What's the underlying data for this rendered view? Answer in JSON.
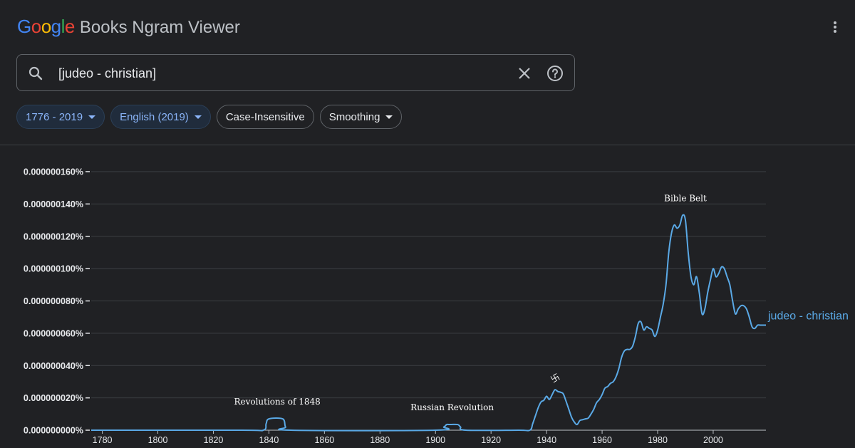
{
  "header": {
    "logo_letters": [
      "G",
      "o",
      "o",
      "g",
      "l",
      "e"
    ],
    "product": "Books Ngram Viewer",
    "menu_icon": "kebab-menu-icon"
  },
  "search": {
    "query": "[judeo - christian]",
    "icons": [
      "search-icon",
      "clear-icon",
      "help-icon"
    ]
  },
  "filters": {
    "year_range": "1776 - 2019",
    "corpus": "English (2019)",
    "case": "Case-Insensitive",
    "smoothing": "Smoothing"
  },
  "colors": {
    "series": "#5aa9e6",
    "accent": "#8ab4f8",
    "background": "#202124"
  },
  "chart_data": {
    "type": "line",
    "title": "",
    "xlabel": "",
    "ylabel": "",
    "xlim": [
      1776,
      2019
    ],
    "ylim": [
      0,
      1.6e-07
    ],
    "x_ticks": [
      1780,
      1800,
      1820,
      1840,
      1860,
      1880,
      1900,
      1920,
      1940,
      1960,
      1980,
      2000
    ],
    "x_tick_labels": [
      "1780",
      "1800",
      "1820",
      "1840",
      "1860",
      "1880",
      "1900",
      "1920",
      "1940",
      "1960",
      "1980",
      "2000"
    ],
    "y_ticks": [
      0,
      2e-08,
      4e-08,
      6e-08,
      8e-08,
      1e-07,
      1.2e-07,
      1.4e-07,
      1.6e-07
    ],
    "y_tick_labels": [
      "0.000000000%",
      "0.000000020%",
      "0.000000040%",
      "0.000000060%",
      "0.000000080%",
      "0.000000100%",
      "0.000000120%",
      "0.000000140%",
      "0.000000160%"
    ],
    "grid": true,
    "series": [
      {
        "name": "judeo - christian",
        "x": [
          1776,
          1830,
          1838,
          1839,
          1840,
          1845,
          1846,
          1848,
          1900,
          1903,
          1904,
          1905,
          1908,
          1909,
          1911,
          1930,
          1934,
          1935,
          1936,
          1937,
          1938,
          1939,
          1940,
          1941,
          1942,
          1943,
          1944,
          1945,
          1946,
          1947,
          1948,
          1949,
          1950,
          1951,
          1952,
          1953,
          1954,
          1955,
          1956,
          1957,
          1958,
          1959,
          1960,
          1961,
          1962,
          1963,
          1964,
          1965,
          1966,
          1967,
          1968,
          1969,
          1970,
          1971,
          1972,
          1973,
          1974,
          1975,
          1976,
          1977,
          1978,
          1979,
          1980,
          1981,
          1982,
          1983,
          1984,
          1985,
          1986,
          1987,
          1988,
          1989,
          1990,
          1991,
          1992,
          1993,
          1994,
          1995,
          1996,
          1997,
          1998,
          1999,
          2000,
          2001,
          2002,
          2003,
          2004,
          2005,
          2006,
          2007,
          2008,
          2009,
          2010,
          2011,
          2012,
          2013,
          2014,
          2015,
          2016,
          2017,
          2018,
          2019
        ],
        "values": [
          0,
          0,
          0,
          4e-09,
          7e-09,
          7e-09,
          2e-09,
          0,
          0,
          2e-09,
          3.5e-09,
          3.5e-09,
          3.5e-09,
          2e-09,
          0,
          0,
          0,
          4e-09,
          9e-09,
          1.4e-08,
          1.75e-08,
          1.85e-08,
          2.1e-08,
          1.9e-08,
          2.2e-08,
          2.5e-08,
          2.4e-08,
          2.35e-08,
          2.25e-08,
          1.8e-08,
          1.3e-08,
          8e-09,
          5e-09,
          3.5e-09,
          6e-09,
          6.5e-09,
          7e-09,
          7.5e-09,
          1e-08,
          1.3e-08,
          1.7e-08,
          1.9e-08,
          2.2e-08,
          2.6e-08,
          2.7e-08,
          2.9e-08,
          3e-08,
          3.3e-08,
          3.8e-08,
          4.5e-08,
          4.9e-08,
          5e-08,
          5e-08,
          5.2e-08,
          5.8e-08,
          6.6e-08,
          6.7e-08,
          6.2e-08,
          6.4e-08,
          6.3e-08,
          6.2e-08,
          5.8e-08,
          6.2e-08,
          7e-08,
          7.8e-08,
          9e-08,
          1.1e-07,
          1.22e-07,
          1.27e-07,
          1.25e-07,
          1.27e-07,
          1.33e-07,
          1.3e-07,
          1.1e-07,
          9.5e-08,
          9e-08,
          9.5e-08,
          8.5e-08,
          7.2e-08,
          7.5e-08,
          8.5e-08,
          9.3e-08,
          1e-07,
          9.5e-08,
          9.7e-08,
          1.01e-07,
          1e-07,
          9.5e-08,
          9e-08,
          8e-08,
          7.2e-08,
          7.5e-08,
          7.7e-08,
          7.7e-08,
          7.5e-08,
          7e-08,
          6.4e-08,
          6.3e-08,
          6.5e-08,
          6.5e-08,
          6.5e-08,
          6.5e-08
        ]
      }
    ],
    "annotations": [
      {
        "text": "Revolutions of 1848",
        "x": 1843
      },
      {
        "text": "Russian Revolution",
        "x": 1906
      },
      {
        "text": "卐",
        "x": 1943
      },
      {
        "text": "Bible Belt",
        "x": 1990
      }
    ]
  }
}
